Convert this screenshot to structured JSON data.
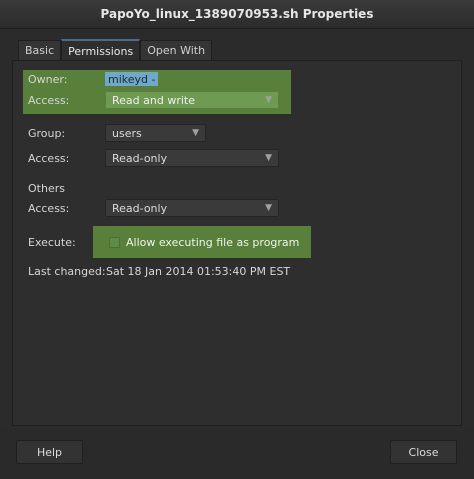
{
  "window": {
    "title": "PapoYo_linux_1389070953.sh Properties"
  },
  "tabs": [
    {
      "label": "Basic",
      "active": false
    },
    {
      "label": "Permissions",
      "active": true
    },
    {
      "label": "Open With",
      "active": false
    }
  ],
  "owner": {
    "label": "Owner:",
    "value": "mikeyd -",
    "access_label": "Access:",
    "access_value": "Read and write"
  },
  "group": {
    "label": "Group:",
    "value": "users",
    "access_label": "Access:",
    "access_value": "Read-only"
  },
  "others": {
    "label": "Others",
    "access_label": "Access:",
    "access_value": "Read-only"
  },
  "execute": {
    "label": "Execute:",
    "checkbox_label": "Allow executing file as program",
    "checked": false
  },
  "last_changed": {
    "label": "Last changed:",
    "value": "Sat 18 Jan 2014 01:53:40 PM EST"
  },
  "buttons": {
    "help": "Help",
    "close": "Close"
  },
  "colors": {
    "highlight": "#5d8a3d",
    "selection": "#6fa9c8",
    "background": "#2e2e2e"
  }
}
